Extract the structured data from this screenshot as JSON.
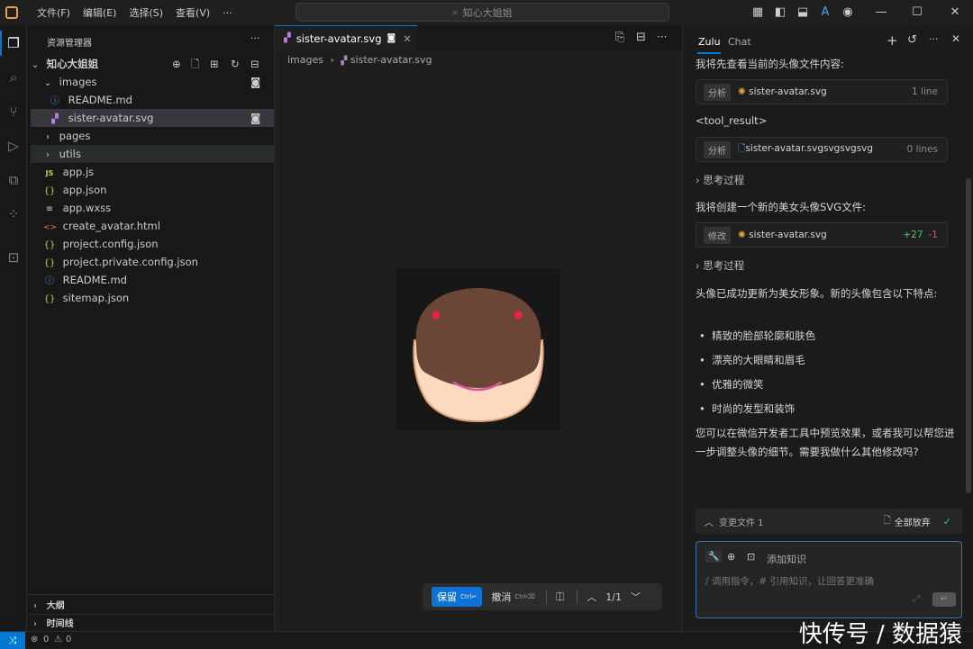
{
  "menu": [
    "文件(F)",
    "编辑(E)",
    "选择(S)",
    "查看(V)",
    "···"
  ],
  "search": {
    "text": "知心大姐姐"
  },
  "sidebar": {
    "title": "资源管理器",
    "more": "···",
    "root": "知心大姐姐",
    "items": [
      {
        "label": "images",
        "kind": "folder-open"
      },
      {
        "label": "README.md",
        "kind": "info"
      },
      {
        "label": "sister-avatar.svg",
        "kind": "svg"
      },
      {
        "label": "pages",
        "kind": "folder"
      },
      {
        "label": "utils",
        "kind": "folder"
      },
      {
        "label": "app.js",
        "kind": "js",
        "icon": "JS"
      },
      {
        "label": "app.json",
        "kind": "json",
        "icon": "{}"
      },
      {
        "label": "app.wxss",
        "kind": "wxss",
        "icon": "≡"
      },
      {
        "label": "create_avatar.html",
        "kind": "html",
        "icon": "<>"
      },
      {
        "label": "project.config.json",
        "kind": "json",
        "icon": "{}"
      },
      {
        "label": "project.private.config.json",
        "kind": "json",
        "icon": "{}"
      },
      {
        "label": "README.md",
        "kind": "info",
        "icon": "ⓘ"
      },
      {
        "label": "sitemap.json",
        "kind": "json",
        "icon": "{}"
      }
    ],
    "outline": "大纲",
    "timeline": "时间线"
  },
  "editor": {
    "tab": "sister-avatar.svg",
    "breadcrumb": [
      "images",
      "sister-avatar.svg"
    ],
    "actions": {
      "keep": "保留",
      "keep_shortcut": "Ctrl↵",
      "undo": "撤消",
      "undo_shortcut": "Ctrl⌫",
      "page": "1/1"
    }
  },
  "panel": {
    "tabs": [
      "Zulu",
      "Chat"
    ],
    "messages": {
      "m1": "我将先查看当前的头像文件内容:",
      "tool1": {
        "tag": "分析",
        "file": "sister-avatar.svg",
        "right": "1 line"
      },
      "tool_result": "<tool_result>",
      "tool2": {
        "tag": "分析",
        "file": "sister-avatar.svgsvgsvgsvg",
        "right": "0 lines"
      },
      "thinking1": "思考过程",
      "m2": "我将创建一个新的美女头像SVG文件:",
      "tool3": {
        "tag": "修改",
        "file": "sister-avatar.svg",
        "add": "+27",
        "del": "-1"
      },
      "thinking2": "思考过程",
      "m3": "头像已成功更新为美女形象。新的头像包含以下特点:",
      "bullets": [
        "精致的脸部轮廓和肤色",
        "漂亮的大眼睛和眉毛",
        "优雅的微笑",
        "时尚的发型和装饰"
      ],
      "m4": "您可以在微信开发者工具中预览效果，或者我可以帮您进一步调整头像的细节。需要我做什么其他修改吗?"
    },
    "changes": {
      "label": "变更文件 1",
      "discard": "全部放弃"
    },
    "input": {
      "knowledge": "添加知识",
      "placeholder": "/ 调用指令，# 引用知识，让回答更准确"
    }
  },
  "status": {
    "errors": "0",
    "warnings": "0"
  },
  "watermark": "快传号 / 数据猿",
  "colors": {
    "accent": "#0078d4",
    "hair": "#6b4636",
    "skin": "#fdd9bf",
    "smile": "#d65a9b",
    "eye": "#e8204c",
    "add": "#4ec16c",
    "del": "#f14c4c"
  }
}
